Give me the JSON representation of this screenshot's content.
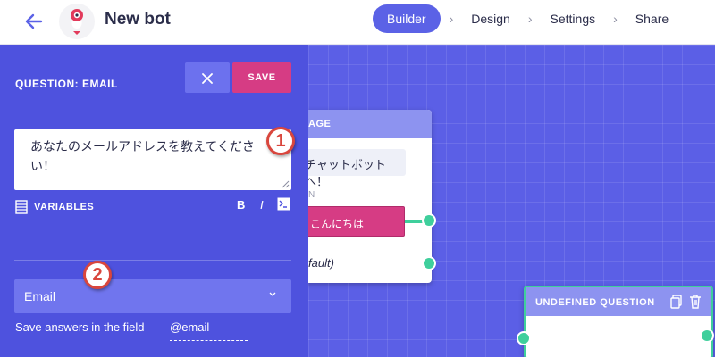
{
  "header": {
    "title": "New bot",
    "steps": [
      "Builder",
      "Design",
      "Settings",
      "Share"
    ]
  },
  "panel": {
    "title": "QUESTION: EMAIL",
    "save_label": "SAVE",
    "question_text": "あなたのメールアドレスを教えてください！",
    "variables_label": "VARIABLES",
    "bold_label": "B",
    "italic_label": "I",
    "answer_type": "Email",
    "save_field_label": "Save answers in the field",
    "save_field_value": "@email"
  },
  "canvas": {
    "node1": {
      "header": "AGE",
      "bubble": "チャットボットへ！",
      "label": "N",
      "choice": "こんにちは",
      "default": "fault)"
    },
    "node2": {
      "header": "UNDEFINED QUESTION"
    }
  },
  "annotations": [
    "1",
    "2"
  ],
  "colors": {
    "primary": "#5b62e6",
    "accent": "#d63c84",
    "panel": "#4e52de",
    "connector": "#3fcf9c"
  }
}
